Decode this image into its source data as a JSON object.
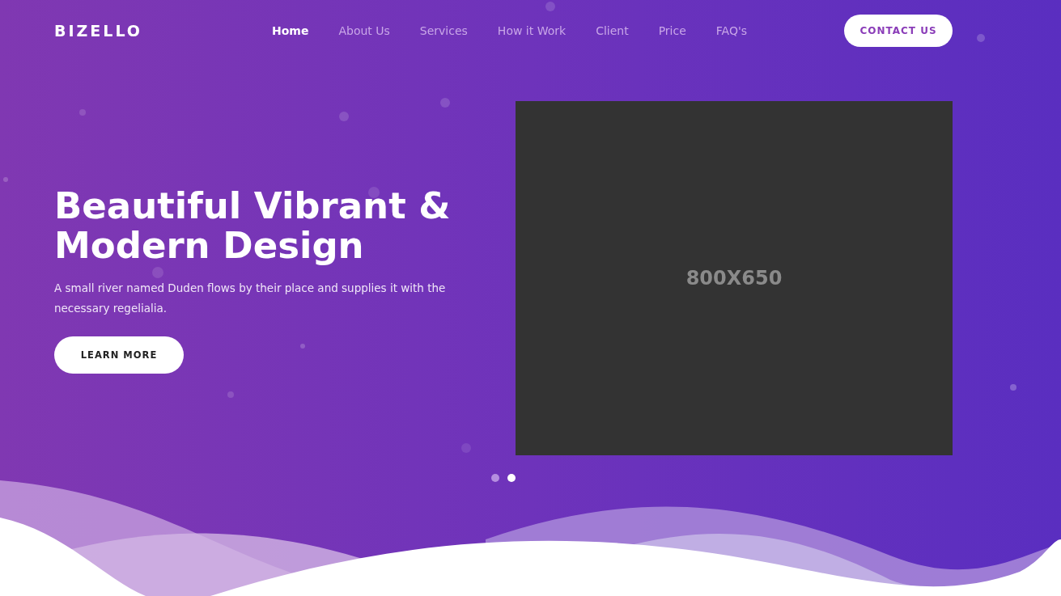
{
  "header": {
    "logo": "BIZELLO",
    "nav": [
      {
        "label": "Home",
        "selected": true
      },
      {
        "label": "About Us",
        "selected": false
      },
      {
        "label": "Services",
        "selected": false
      },
      {
        "label": "How it Work",
        "selected": false
      },
      {
        "label": "Client",
        "selected": false
      },
      {
        "label": "Price",
        "selected": false
      },
      {
        "label": "FAQ's",
        "selected": false
      }
    ],
    "cta": "CONTACT US"
  },
  "hero": {
    "title": "Beautiful Vibrant & Modern Design",
    "text": "A small river named Duden flows by their place and supplies it with the necessary regelialia.",
    "button": "LEARN MORE",
    "image_placeholder": "800X650",
    "slider_dots": [
      {
        "selected": false
      },
      {
        "selected": true
      }
    ]
  }
}
